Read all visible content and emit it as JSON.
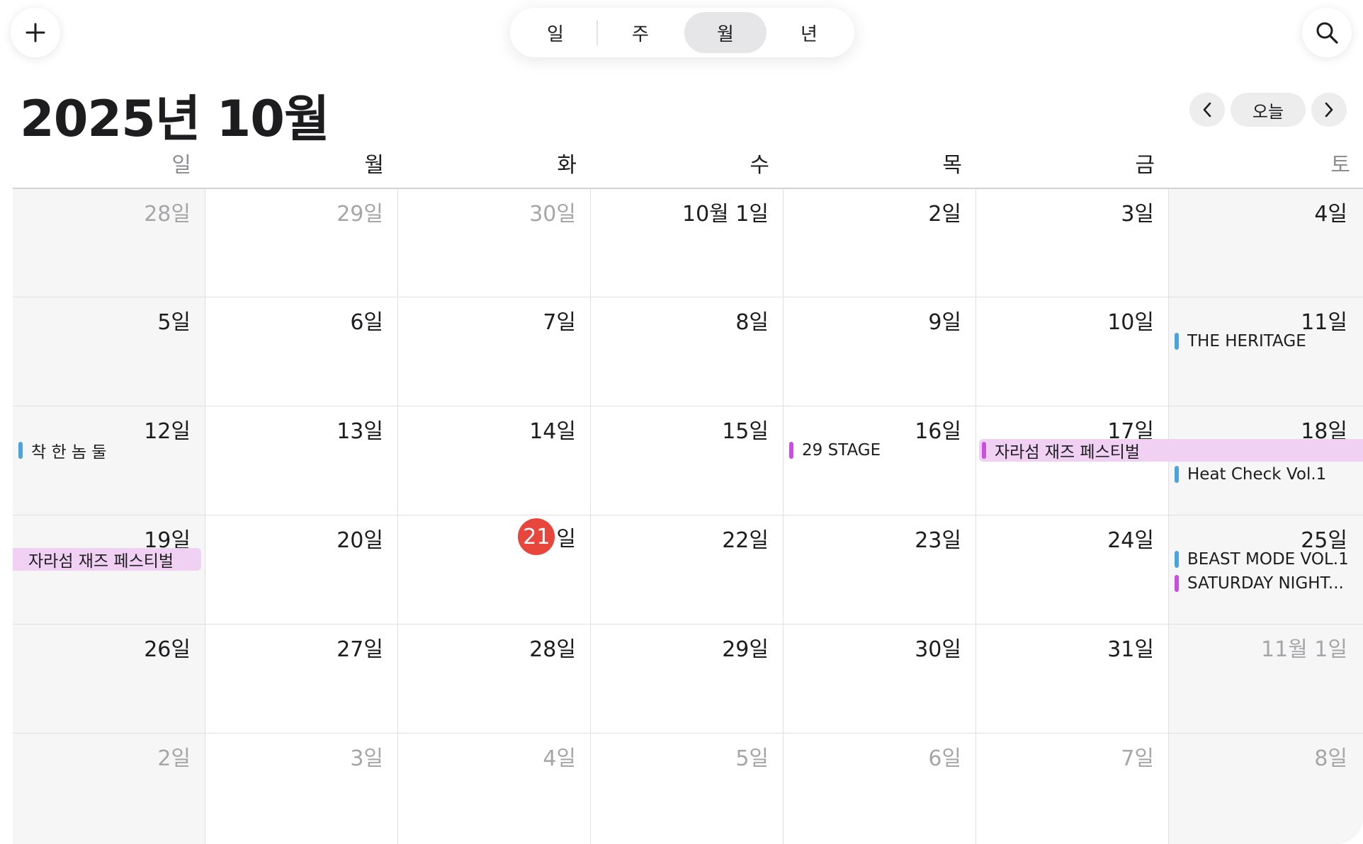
{
  "toolbar": {
    "view_tabs": [
      "일",
      "주",
      "월",
      "년"
    ],
    "active_tab": "월"
  },
  "header": {
    "title": "2025년 10월"
  },
  "nav": {
    "today_label": "오늘"
  },
  "weekdays": [
    "일",
    "월",
    "화",
    "수",
    "목",
    "금",
    "토"
  ],
  "weeks": [
    [
      {
        "label": "28일",
        "dim": true
      },
      {
        "label": "29일",
        "dim": true
      },
      {
        "label": "30일",
        "dim": true
      },
      {
        "label": "10월 1일"
      },
      {
        "label": "2일"
      },
      {
        "label": "3일"
      },
      {
        "label": "4일"
      }
    ],
    [
      {
        "label": "5일"
      },
      {
        "label": "6일"
      },
      {
        "label": "7일"
      },
      {
        "label": "8일"
      },
      {
        "label": "9일"
      },
      {
        "label": "10일"
      },
      {
        "label": "11일"
      }
    ],
    [
      {
        "label": "12일"
      },
      {
        "label": "13일"
      },
      {
        "label": "14일"
      },
      {
        "label": "15일"
      },
      {
        "label": "16일"
      },
      {
        "label": "17일"
      },
      {
        "label": "18일"
      }
    ],
    [
      {
        "label": "19일"
      },
      {
        "label": "20일"
      },
      {
        "label": "21",
        "today": true,
        "suffix": "일"
      },
      {
        "label": "22일"
      },
      {
        "label": "23일"
      },
      {
        "label": "24일"
      },
      {
        "label": "25일"
      }
    ],
    [
      {
        "label": "26일"
      },
      {
        "label": "27일"
      },
      {
        "label": "28일"
      },
      {
        "label": "29일"
      },
      {
        "label": "30일"
      },
      {
        "label": "31일"
      },
      {
        "label": "11월 1일",
        "dim": true
      }
    ],
    [
      {
        "label": "2일",
        "dim": true
      },
      {
        "label": "3일",
        "dim": true
      },
      {
        "label": "4일",
        "dim": true
      },
      {
        "label": "5일",
        "dim": true
      },
      {
        "label": "6일",
        "dim": true
      },
      {
        "label": "7일",
        "dim": true
      },
      {
        "label": "8일",
        "dim": true
      }
    ]
  ],
  "events": [
    {
      "title": "THE HERITAGE",
      "week": 1,
      "day": 6,
      "slot": 0,
      "color": "#4aa3df",
      "style": "dot"
    },
    {
      "title": "착 한 놈 둘",
      "week": 2,
      "day": 0,
      "slot": 0,
      "color": "#4aa3df",
      "style": "dot"
    },
    {
      "title": "29 STAGE",
      "week": 2,
      "day": 4,
      "slot": 0,
      "color": "#c94fe0",
      "style": "dot"
    },
    {
      "title": "자라섬 재즈 페스티벌",
      "week": 2,
      "day": 5,
      "span": 2,
      "slot": 0,
      "color": "#c94fe0",
      "style": "band"
    },
    {
      "title": "Heat Check Vol.1",
      "week": 2,
      "day": 6,
      "slot": 1,
      "color": "#4aa3df",
      "style": "dot"
    },
    {
      "title": "자라섬 재즈 페스티벌",
      "week": 3,
      "day": 0,
      "slot": 0,
      "color": "#c94fe0",
      "style": "band-cont"
    },
    {
      "title": "BEAST MODE VOL.1",
      "week": 3,
      "day": 6,
      "slot": 0,
      "color": "#4aa3df",
      "style": "dot"
    },
    {
      "title": "SATURDAY NIGHT...",
      "week": 3,
      "day": 6,
      "slot": 1,
      "color": "#c94fe0",
      "style": "dot"
    }
  ],
  "colors": {
    "today": "#e8453c",
    "blue_calendar": "#4aa3df",
    "purple_calendar": "#c94fe0"
  }
}
